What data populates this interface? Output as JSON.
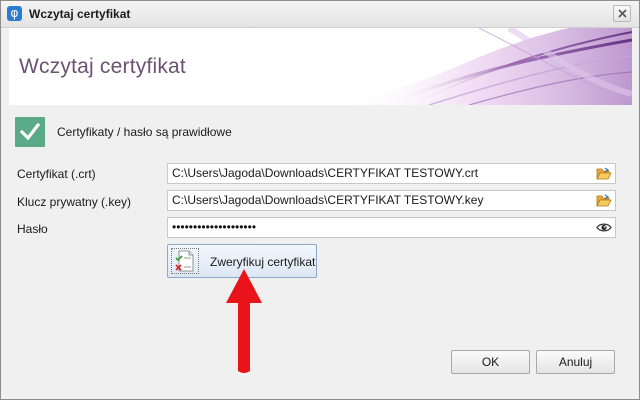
{
  "window": {
    "title": "Wczytaj certyfikat",
    "app_icon": "phi-icon",
    "close_icon": "close-icon"
  },
  "header": {
    "title": "Wczytaj certyfikat",
    "accent_color": "#6a5270"
  },
  "status": {
    "icon": "checkmark-icon",
    "color": "#5aa987",
    "text": "Certyfikaty / hasło są prawidłowe"
  },
  "fields": {
    "certificate": {
      "label": "Certyfikat (.crt)",
      "value": "C:\\Users\\Jagoda\\Downloads\\CERTYFIKAT TESTOWY.crt",
      "button_icon": "folder-open-icon"
    },
    "private_key": {
      "label": "Klucz prywatny (.key)",
      "value": "C:\\Users\\Jagoda\\Downloads\\CERTYFIKAT TESTOWY.key",
      "button_icon": "folder-open-icon"
    },
    "password": {
      "label": "Hasło",
      "value": "••••••••••••••••••••",
      "button_icon": "eye-icon"
    }
  },
  "verify_button": {
    "label": "Zweryfikuj certyfikat",
    "icon": "document-check-icon"
  },
  "annotation": {
    "icon": "red-arrow-up-icon",
    "color": "#e8141a"
  },
  "buttons": {
    "ok": "OK",
    "cancel": "Anuluj"
  }
}
